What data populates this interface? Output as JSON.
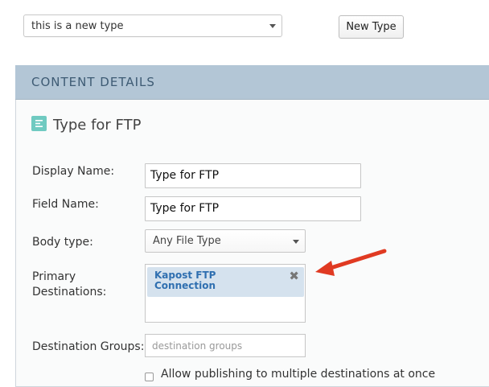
{
  "type_selector": {
    "selected": "this is a new type",
    "new_type_button": "New Type"
  },
  "panel": {
    "header": "CONTENT DETAILS",
    "section_title": "Type for FTP",
    "display_name": {
      "label": "Display Name:",
      "value": "Type for FTP"
    },
    "field_name": {
      "label": "Field Name:",
      "value": "Type for FTP"
    },
    "body_type": {
      "label": "Body type:",
      "value": "Any File Type"
    },
    "primary_destinations": {
      "label_line1": "Primary",
      "label_line2": "Destinations:",
      "tag_line1": "Kapost FTP",
      "tag_line2": "Connection",
      "remove_glyph": "✖"
    },
    "destination_groups": {
      "label": "Destination Groups:",
      "placeholder": "destination groups"
    },
    "multi_publish": {
      "label": "Allow publishing to multiple destinations at once"
    }
  },
  "colors": {
    "header_bg": "#b3c6d6",
    "header_text": "#3e5b74",
    "section_icon": "#6fcac1",
    "tag_bg": "#d5e2ee",
    "tag_text": "#2f6fb0",
    "arrow": "#e03a22"
  }
}
